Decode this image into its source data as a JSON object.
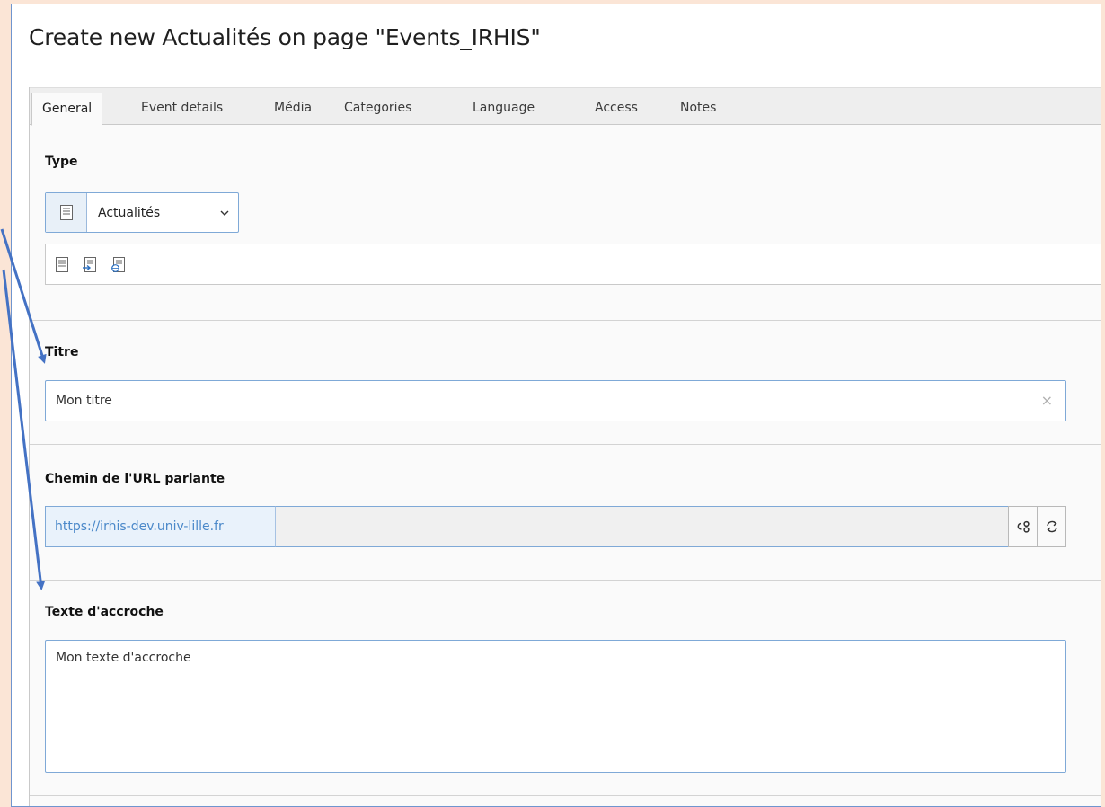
{
  "page_title": "Create new Actualités on page \"Events_IRHIS\"",
  "tabs": [
    {
      "label": "General",
      "active": true
    },
    {
      "label": "Event details",
      "active": false
    },
    {
      "label": "Média",
      "active": false
    },
    {
      "label": "Categories",
      "active": false
    },
    {
      "label": "Language",
      "active": false
    },
    {
      "label": "Access",
      "active": false
    },
    {
      "label": "Notes",
      "active": false
    }
  ],
  "type_section": {
    "label": "Type",
    "selected_value": "Actualités",
    "type_icons": [
      "news-document-icon",
      "news-internal-link-icon",
      "news-external-link-icon"
    ]
  },
  "titre_section": {
    "label": "Titre",
    "value": "Mon titre",
    "clear_glyph": "×"
  },
  "url_section": {
    "label": "Chemin de l'URL parlante",
    "prefix": "https://irhis-dev.univ-lille.fr",
    "value": "",
    "buttons": [
      "unlink-icon",
      "refresh-icon"
    ]
  },
  "teaser_section": {
    "label": "Texte d'accroche",
    "value": "Mon texte d'accroche"
  },
  "colors": {
    "page_background": "#fbe5d6",
    "accent_border": "#7fa9d7",
    "annotation_arrow": "#4472c4",
    "url_prefix_text": "#4a88c9"
  }
}
